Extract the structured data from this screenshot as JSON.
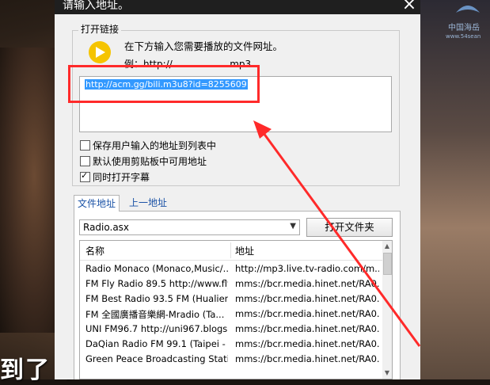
{
  "video": {
    "watermark": "中国海岳",
    "watermark_url": "www.54sean",
    "subtitle": "到了 ブ"
  },
  "dialog": {
    "title": "请输入地址。",
    "group_label": "打开链接",
    "instruction": "在下方输入您需要播放的文件网址。",
    "example": "例：http://...................mp3",
    "url_value": "http://acm.gg/bili.m3u8?id=8255609",
    "checkboxes": [
      {
        "label": "保存用户输入的地址到列表中",
        "checked": false
      },
      {
        "label": "默认使用剪贴板中可用地址",
        "checked": false
      },
      {
        "label": "同时打开字幕",
        "checked": true
      }
    ],
    "tabs": [
      {
        "label": "文件地址",
        "active": true
      },
      {
        "label": "上一地址",
        "active": false
      }
    ],
    "combo_value": "Radio.asx",
    "open_folder_button": "打开文件夹",
    "list": {
      "columns": [
        "名称",
        "地址"
      ],
      "rows": [
        {
          "name": "Radio Monaco (Monaco,Music/...",
          "address": "http://mp3.live.tv-radio.com/m..."
        },
        {
          "name": "FM Fly Radio 89.5 http://www.fly...",
          "address": "mms://bcr.media.hinet.net/RA0..."
        },
        {
          "name": "FM Best Radio 93.5 FM (Hualien ...",
          "address": "mms://bcr.media.hinet.net/RA0..."
        },
        {
          "name": "FM 全國廣播音樂網-Mradio (Ta...",
          "address": "mms://bcr.media.hinet.net/RA0..."
        },
        {
          "name": "UNI FM96.7 http://uni967.blogsp...",
          "address": "mms://bcr.media.hinet.net/RA0..."
        },
        {
          "name": "DaQian Radio FM 99.1 (Taipei - T...",
          "address": "mms://bcr.media.hinet.net/RA0..."
        },
        {
          "name": "Green Peace Broadcasting Statio...",
          "address": "mms://bcr.media.hinet.net/RA0..."
        }
      ]
    }
  },
  "colors": {
    "highlight": "#3399ff",
    "annotation": "#ff2a2a",
    "play_icon": "#f5c400",
    "tab_text": "#1a52a6"
  }
}
